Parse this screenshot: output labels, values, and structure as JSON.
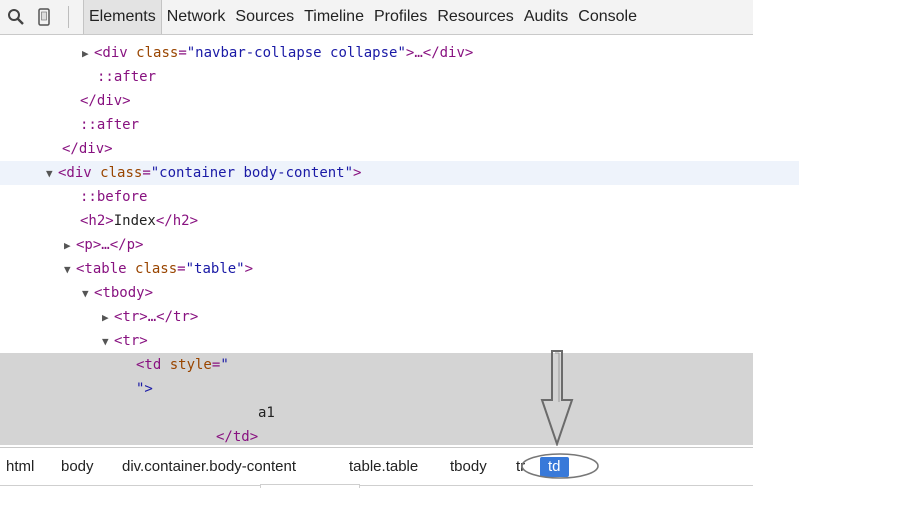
{
  "toolbar": {
    "icons": [
      "search-icon",
      "device-icon"
    ],
    "tabs": [
      {
        "label": "Elements",
        "active": true
      },
      {
        "label": "Network"
      },
      {
        "label": "Sources"
      },
      {
        "label": "Timeline"
      },
      {
        "label": "Profiles"
      },
      {
        "label": "Resources"
      },
      {
        "label": "Audits"
      },
      {
        "label": "Console"
      }
    ]
  },
  "tree": {
    "l1": {
      "tag_open": "<div ",
      "attr": "class",
      "eq": "=",
      "val": "\"navbar-collapse collapse\"",
      "tail": ">…</div>"
    },
    "l2": "::after",
    "l3": "</div>",
    "l4": "::after",
    "l5": "</div>",
    "l6": {
      "tag_open": "<div ",
      "attr": "class",
      "eq": "=",
      "val": "\"container body-content\"",
      "tail": ">"
    },
    "l7": "::before",
    "l8": {
      "open": "<h2>",
      "text": "Index",
      "close": "</h2>"
    },
    "l9": "<p>…</p>",
    "l10": {
      "tag_open": "<table ",
      "attr": "class",
      "eq": "=",
      "val": "\"table\"",
      "tail": ">"
    },
    "l11": "<tbody>",
    "l12": "<tr>…</tr>",
    "l13": "<tr>",
    "l14": {
      "tag_open": "<td ",
      "attr": "style",
      "eq": "=",
      "val": "\""
    },
    "l15": "\">",
    "l16": "a1",
    "l17": "</td>"
  },
  "breadcrumbs": [
    "html",
    "body",
    "div.container.body-content",
    "table.table",
    "tbody",
    "tr",
    "td"
  ],
  "colors": {
    "accent": "#3879d9",
    "selected_row": "#eef3fb",
    "highlight_block": "#d4d4d4"
  }
}
